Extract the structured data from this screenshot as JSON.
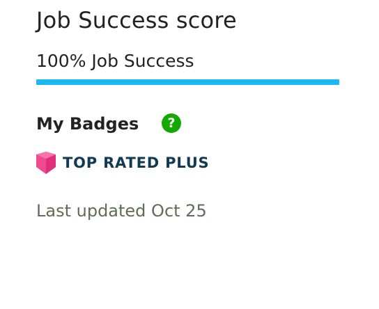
{
  "job_success": {
    "title": "Job Success score",
    "score_text": "100% Job Success",
    "progress_fraction": 1.0,
    "progress_color": "#1db8f2"
  },
  "badges": {
    "heading": "My Badges",
    "help_icon": "question-circle-icon",
    "help_glyph": "?",
    "items": [
      {
        "label": "TOP RATED PLUS",
        "icon": "top-rated-plus-badge-icon",
        "color": "#f0498f"
      }
    ]
  },
  "last_updated": "Last updated Oct 25"
}
